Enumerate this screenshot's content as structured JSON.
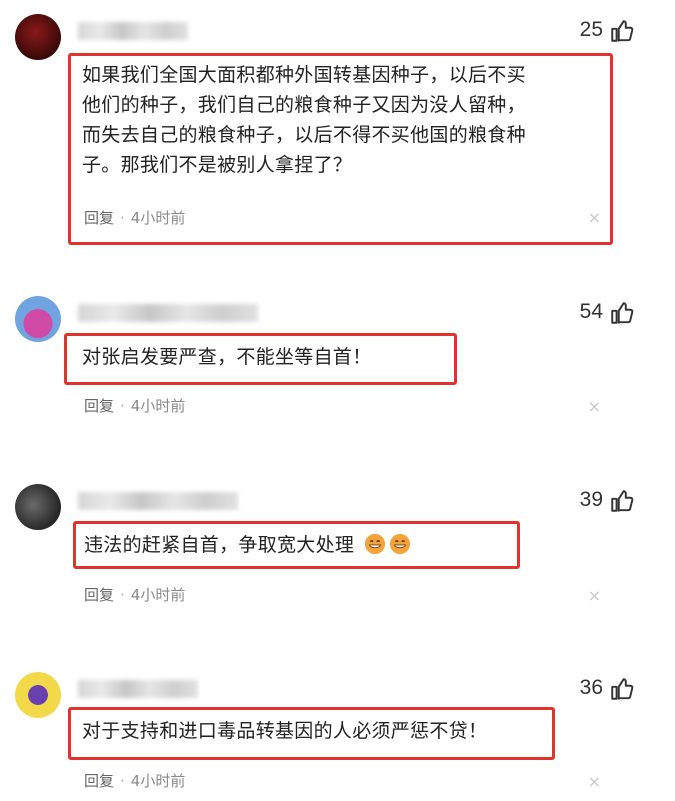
{
  "comments": [
    {
      "likes": "25",
      "text_lines": [
        "如果我们全国大面积都种外国转基因种子，以后不买",
        "他们的种子，我们自己的粮食种子又因为没人留种，",
        "而失去自己的粮食种子，以后不得不买他国的粮食种",
        "子。那我们不是被别人拿捏了？"
      ],
      "reply_label": "回复",
      "time": "4小时前",
      "close": "×"
    },
    {
      "likes": "54",
      "text_lines": [
        "对张启发要严查，不能坐等自首！"
      ],
      "reply_label": "回复",
      "time": "4小时前",
      "close": "×"
    },
    {
      "likes": "39",
      "text_lines": [
        "违法的赶紧自首，争取宽大处理"
      ],
      "reply_label": "回复",
      "time": "4小时前",
      "close": "×"
    },
    {
      "likes": "36",
      "text_lines": [
        "对于支持和进口毒品转基因的人必须严惩不贷！"
      ],
      "reply_label": "回复",
      "time": "4小时前",
      "close": "×"
    }
  ],
  "icons": {
    "like": "thumbs-up-icon",
    "emoji": "grinning-face-icon"
  },
  "colors": {
    "highlight_border": "#e0332c",
    "meta_text": "#8a8a8a"
  }
}
